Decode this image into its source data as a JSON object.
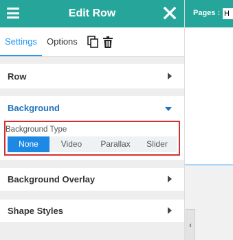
{
  "header": {
    "title": "Edit Row"
  },
  "tabs": [
    {
      "label": "Settings",
      "active": true
    },
    {
      "label": "Options",
      "active": false
    }
  ],
  "sections": {
    "row": {
      "label": "Row"
    },
    "background": {
      "label": "Background"
    },
    "background_overlay": {
      "label": "Background Overlay"
    },
    "shape_styles": {
      "label": "Shape Styles"
    }
  },
  "background_type": {
    "label": "Background Type",
    "options": [
      "None",
      "Video",
      "Parallax",
      "Slider"
    ],
    "selected": "None"
  },
  "topbar": {
    "pages_label": "Pages :",
    "pages_value": "H"
  },
  "collapse_handle": {
    "glyph": "‹"
  },
  "colors": {
    "header": "#26a69a",
    "accent": "#1e88e5",
    "highlight_border": "#d32f2f",
    "section_open": "#1e73be"
  },
  "icons": [
    "hamburger-menu-icon",
    "close-icon",
    "copy-icon",
    "trash-icon",
    "caret-right-icon",
    "caret-down-icon"
  ]
}
